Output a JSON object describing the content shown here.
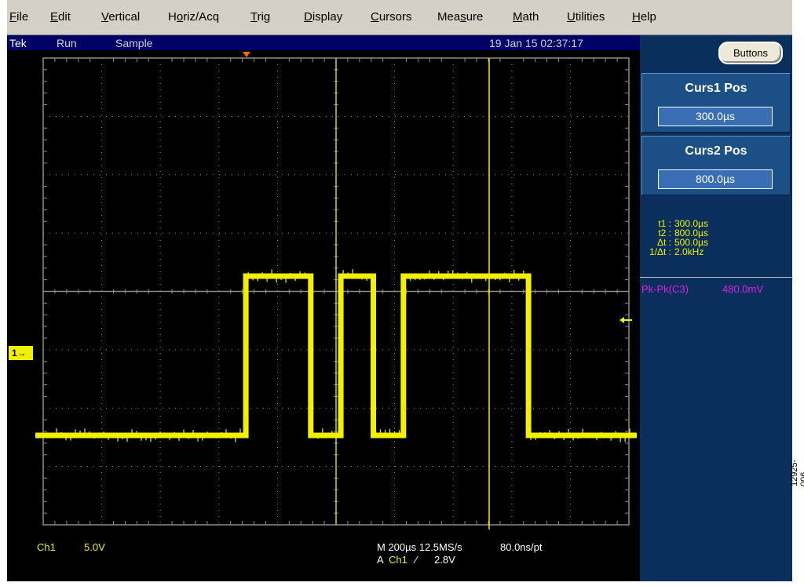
{
  "menu": [
    "File",
    "Edit",
    "Vertical",
    "Horiz/Acq",
    "Trig",
    "Display",
    "Cursors",
    "Measure",
    "Math",
    "Utilities",
    "Help"
  ],
  "menu_underline": [
    "F",
    "E",
    "V",
    "o",
    "T",
    "D",
    "C",
    "s",
    "M",
    "U",
    "H"
  ],
  "status": {
    "brand": "Tek",
    "run": "Run",
    "mode": "Sample",
    "datetime": "19 Jan 15 02:37:17"
  },
  "side": {
    "buttons_label": "Buttons",
    "curs1": {
      "label": "Curs1 Pos",
      "value": "300.0µs"
    },
    "curs2": {
      "label": "Curs2 Pos",
      "value": "800.0µs"
    },
    "readouts": [
      {
        "label": "t1 :",
        "value": "300.0µs"
      },
      {
        "label": "t2 :",
        "value": "800.0µs"
      },
      {
        "label": "Δt :",
        "value": "500.0µs"
      },
      {
        "label": "1/Δt :",
        "value": "2.0kHz"
      }
    ],
    "measurement": {
      "label": "Pk-Pk(C3)",
      "value": "480.0mV"
    }
  },
  "bottom": {
    "channel": "Ch1",
    "scale": "5.0V",
    "timebase": "M 200µs 12.5MS/s",
    "sample_interval": "80.0ns/pt",
    "trigger_prefix": "A",
    "trigger_source": "Ch1",
    "trigger_slope": "⁄",
    "trigger_level": "2.8V"
  },
  "channel_marker": "1→",
  "figure_id": "12925-006",
  "colors": {
    "trace": "#f0f000",
    "grid": "#8c8c8c",
    "background": "#000000",
    "panel": "#0b2f5c",
    "measure": "#e020e0"
  },
  "waveform": {
    "segments": [
      {
        "t0": 0.0,
        "t1": 0.35,
        "level": "low"
      },
      {
        "t0": 0.35,
        "t1": 0.458,
        "level": "high"
      },
      {
        "t0": 0.458,
        "t1": 0.508,
        "level": "low"
      },
      {
        "t0": 0.508,
        "t1": 0.562,
        "level": "high"
      },
      {
        "t0": 0.562,
        "t1": 0.612,
        "level": "low"
      },
      {
        "t0": 0.612,
        "t1": 0.82,
        "level": "high"
      },
      {
        "t0": 0.82,
        "t1": 1.0,
        "level": "low"
      }
    ]
  }
}
